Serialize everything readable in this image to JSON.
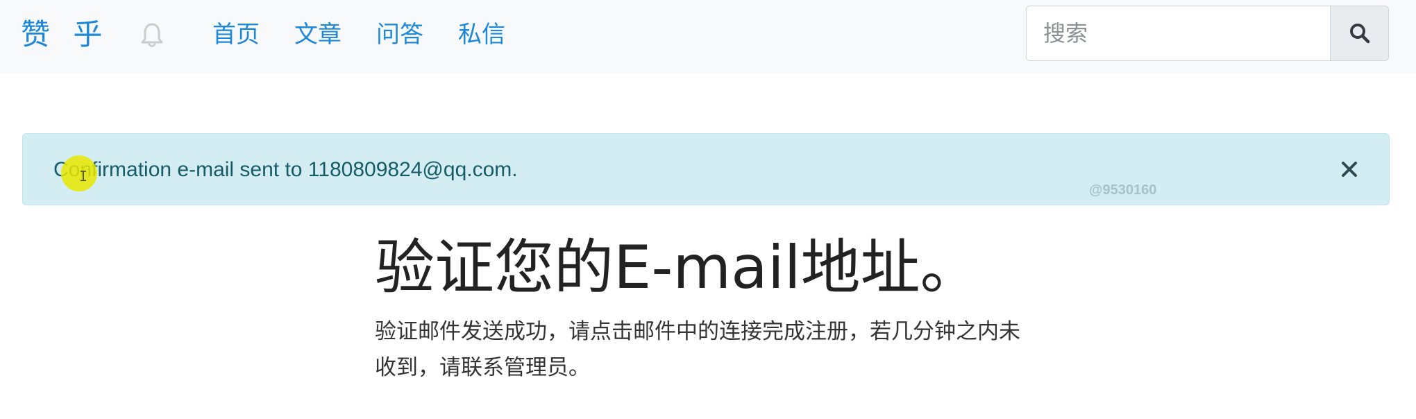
{
  "navbar": {
    "brand": "赞 乎",
    "icons": {
      "bell": "bell-icon",
      "search": "search-icon"
    },
    "links": [
      {
        "label": "首页"
      },
      {
        "label": "文章"
      },
      {
        "label": "问答"
      },
      {
        "label": "私信"
      }
    ],
    "search": {
      "placeholder": "搜索",
      "value": ""
    }
  },
  "alert": {
    "message": "Confirmation e-mail sent to 1180809824@qq.com.",
    "close_icon": "close-icon",
    "watermark": "@9530160"
  },
  "main": {
    "title": "验证您的E-mail地址。",
    "description": "验证邮件发送成功，请点击邮件中的连接完成注册，若几分钟之内未收到，请联系管理员。"
  },
  "colors": {
    "brand": "#1e88d6",
    "navbar_bg": "#f8f9fa",
    "alert_bg": "#d4edf2",
    "alert_text": "#155b68"
  }
}
